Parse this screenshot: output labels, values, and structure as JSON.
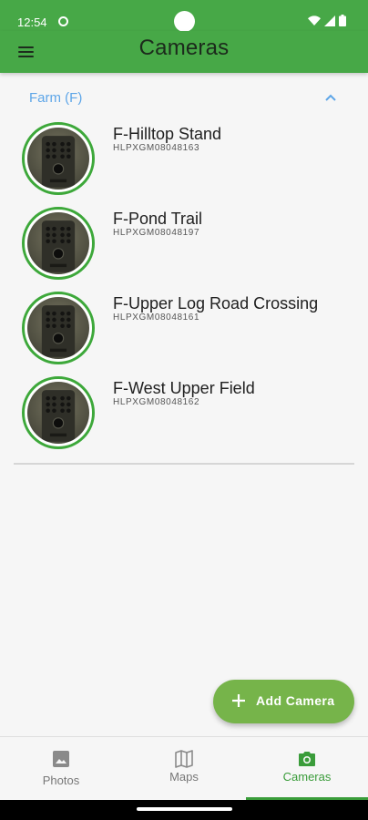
{
  "status_bar": {
    "time": "12:54",
    "icons": [
      "app-notification-icon",
      "wifi-icon",
      "signal-icon",
      "battery-icon"
    ]
  },
  "app_bar": {
    "title": "Cameras",
    "menu_icon": "hamburger-menu-icon",
    "background": "#47a847"
  },
  "group": {
    "title": "Farm (F)",
    "expanded": true,
    "title_color": "#5ea6e8"
  },
  "cameras": [
    {
      "name": "F-Hilltop Stand",
      "serial": "HLPXGM08048163"
    },
    {
      "name": "F-Pond Trail",
      "serial": "HLPXGM08048197"
    },
    {
      "name": "F-Upper Log Road Crossing",
      "serial": "HLPXGM08048161"
    },
    {
      "name": "F-West Upper Field",
      "serial": "HLPXGM08048162"
    }
  ],
  "fab": {
    "label": "Add Camera",
    "icon": "plus-icon",
    "color": "#76b44a"
  },
  "bottom_nav": {
    "items": [
      {
        "label": "Photos",
        "icon": "image-icon",
        "active": false
      },
      {
        "label": "Maps",
        "icon": "map-icon",
        "active": false
      },
      {
        "label": "Cameras",
        "icon": "camera-icon",
        "active": true
      }
    ],
    "active_color": "#3a9c3a"
  },
  "colors": {
    "accent_green": "#47a847",
    "avatar_ring": "#3da83a"
  }
}
